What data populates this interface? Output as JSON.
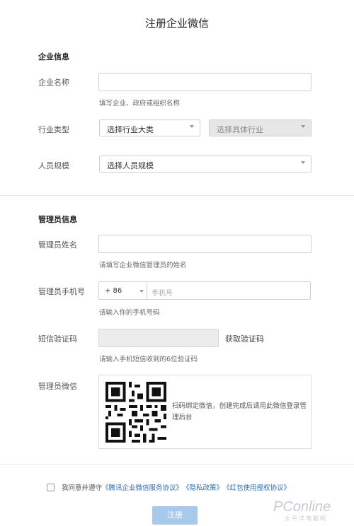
{
  "page": {
    "title": "注册企业微信"
  },
  "company": {
    "section_title": "企业信息",
    "name_label": "企业名称",
    "name_value": "",
    "name_hint": "填写企业、政府或组织名称",
    "industry_label": "行业类型",
    "industry_select": "选择行业大类",
    "industry_sub_select": "选择具体行业",
    "size_label": "人员规模",
    "size_select": "选择人员规模"
  },
  "admin": {
    "section_title": "管理员信息",
    "name_label": "管理员姓名",
    "name_value": "",
    "name_hint": "请填写企业微信管理员的姓名",
    "phone_label": "管理员手机号",
    "country_code": "+ 86",
    "phone_placeholder": "手机号",
    "phone_hint": "请输入你的手机号码",
    "sms_label": "短信验证码",
    "sms_value": "",
    "get_code_label": "获取验证码",
    "sms_hint": "请输入手机短信收到的6位验证码",
    "wechat_label": "管理员微信",
    "qr_text": "扫码绑定微信，创建完成后请用此微信登录管理后台"
  },
  "agreement": {
    "checked": false,
    "prefix": "我同意并遵守",
    "link1": "《腾讯企业微信服务协议》",
    "link2": "《隐私政策》",
    "link3": "《红包使用授权协议》"
  },
  "submit_label": "注册",
  "watermark": {
    "brand": "PConline",
    "sub": "太平洋电脑网"
  }
}
